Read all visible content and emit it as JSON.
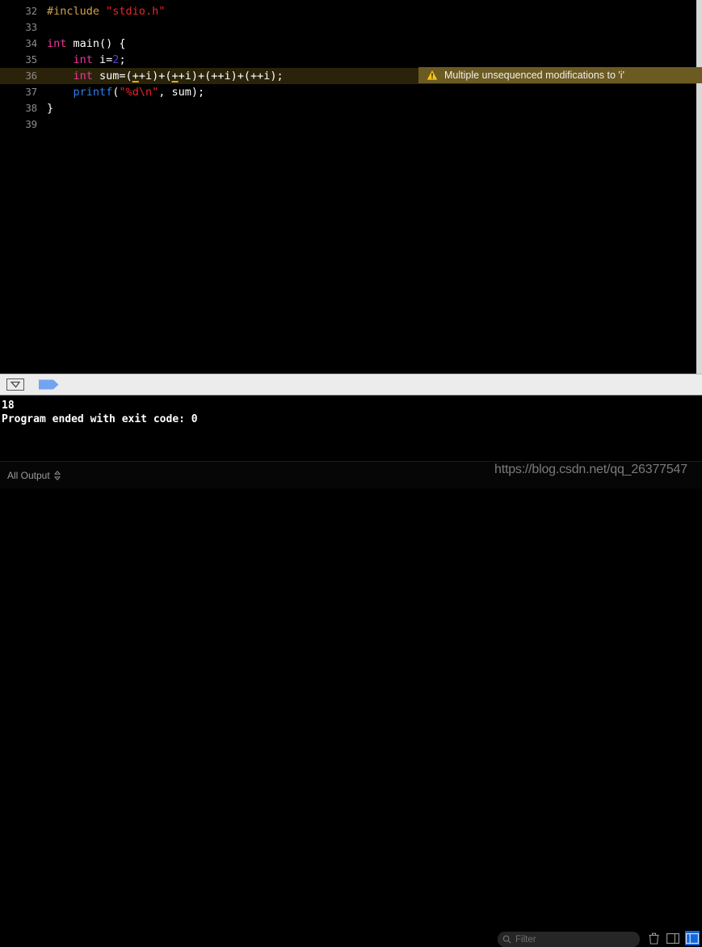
{
  "editor": {
    "lines": [
      {
        "number": "32",
        "highlight": false,
        "tokens": [
          {
            "text": "#include",
            "cls": "tk-pre"
          },
          {
            "text": " ",
            "cls": "tk-plain"
          },
          {
            "text": "\"stdio.h\"",
            "cls": "tk-str"
          }
        ]
      },
      {
        "number": "33",
        "highlight": false,
        "tokens": []
      },
      {
        "number": "34",
        "highlight": false,
        "tokens": [
          {
            "text": "int",
            "cls": "tk-kw"
          },
          {
            "text": " main() {",
            "cls": "tk-plain"
          }
        ]
      },
      {
        "number": "35",
        "highlight": false,
        "tokens": [
          {
            "text": "    ",
            "cls": "tk-plain"
          },
          {
            "text": "int",
            "cls": "tk-kw"
          },
          {
            "text": " i=",
            "cls": "tk-plain"
          },
          {
            "text": "2",
            "cls": "tk-num"
          },
          {
            "text": ";",
            "cls": "tk-plain"
          }
        ]
      },
      {
        "number": "36",
        "highlight": true,
        "tokens": [
          {
            "text": "    ",
            "cls": "tk-plain"
          },
          {
            "text": "int",
            "cls": "tk-kw"
          },
          {
            "text": " sum=(",
            "cls": "tk-plain"
          },
          {
            "text": "+",
            "cls": "tk-warnunder"
          },
          {
            "text": "+i)+(",
            "cls": "tk-plain"
          },
          {
            "text": "+",
            "cls": "tk-warnunder"
          },
          {
            "text": "+i)+(++i)+(++i);",
            "cls": "tk-plain"
          }
        ]
      },
      {
        "number": "37",
        "highlight": false,
        "tokens": [
          {
            "text": "    ",
            "cls": "tk-plain"
          },
          {
            "text": "printf",
            "cls": "tk-fn"
          },
          {
            "text": "(",
            "cls": "tk-plain"
          },
          {
            "text": "\"%d\\n\"",
            "cls": "tk-str"
          },
          {
            "text": ", sum);",
            "cls": "tk-plain"
          }
        ]
      },
      {
        "number": "38",
        "highlight": false,
        "tokens": [
          {
            "text": "}",
            "cls": "tk-plain"
          }
        ]
      },
      {
        "number": "39",
        "highlight": false,
        "tokens": []
      }
    ]
  },
  "warning": {
    "icon": "warning-triangle-icon",
    "message": "Multiple unsequenced modifications to 'i'",
    "background_color": "#6b5a22",
    "icon_color": "#f5c518"
  },
  "console_toolbar": {
    "filter_button_label": "filter-dropdown",
    "marker_label": "breakpoint-flag"
  },
  "console": {
    "lines": [
      "18",
      "Program ended with exit code: 0"
    ]
  },
  "status_bar": {
    "output_scope_label": "All Output",
    "filter_placeholder": "Filter",
    "icons": [
      {
        "name": "trash-icon",
        "active": false
      },
      {
        "name": "toggle-console-pane-icon",
        "active": false
      },
      {
        "name": "toggle-debug-pane-icon",
        "active": true
      }
    ],
    "accent_color": "#1466d8"
  },
  "watermark": {
    "text": "https://blog.csdn.net/qq_26377547"
  }
}
